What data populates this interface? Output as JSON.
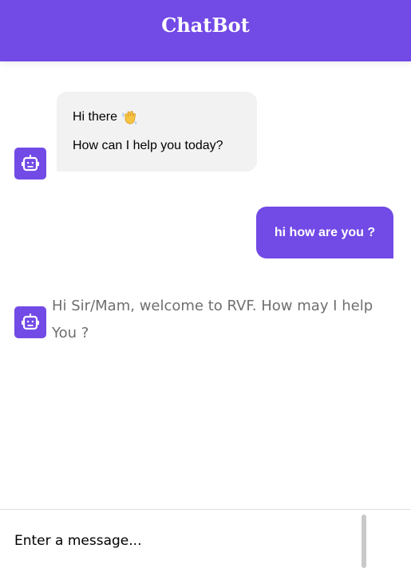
{
  "header": {
    "title": "ChatBot"
  },
  "messages": {
    "bot_first": {
      "line1": "Hi there",
      "line1_icon": "waving-hand-icon",
      "line2": "How can I help you today?"
    },
    "user_first": {
      "text": "hi how are you ?"
    },
    "bot_second": {
      "text": "Hi Sir/Mam, welcome to RVF. How may I help You ?"
    }
  },
  "composer": {
    "placeholder": "Enter a message..."
  },
  "colors": {
    "accent": "#724AE6",
    "bot_bubble": "#f2f2f2",
    "muted_text": "#6f6f6f"
  },
  "icons": {
    "bot_avatar": "robot-icon"
  }
}
